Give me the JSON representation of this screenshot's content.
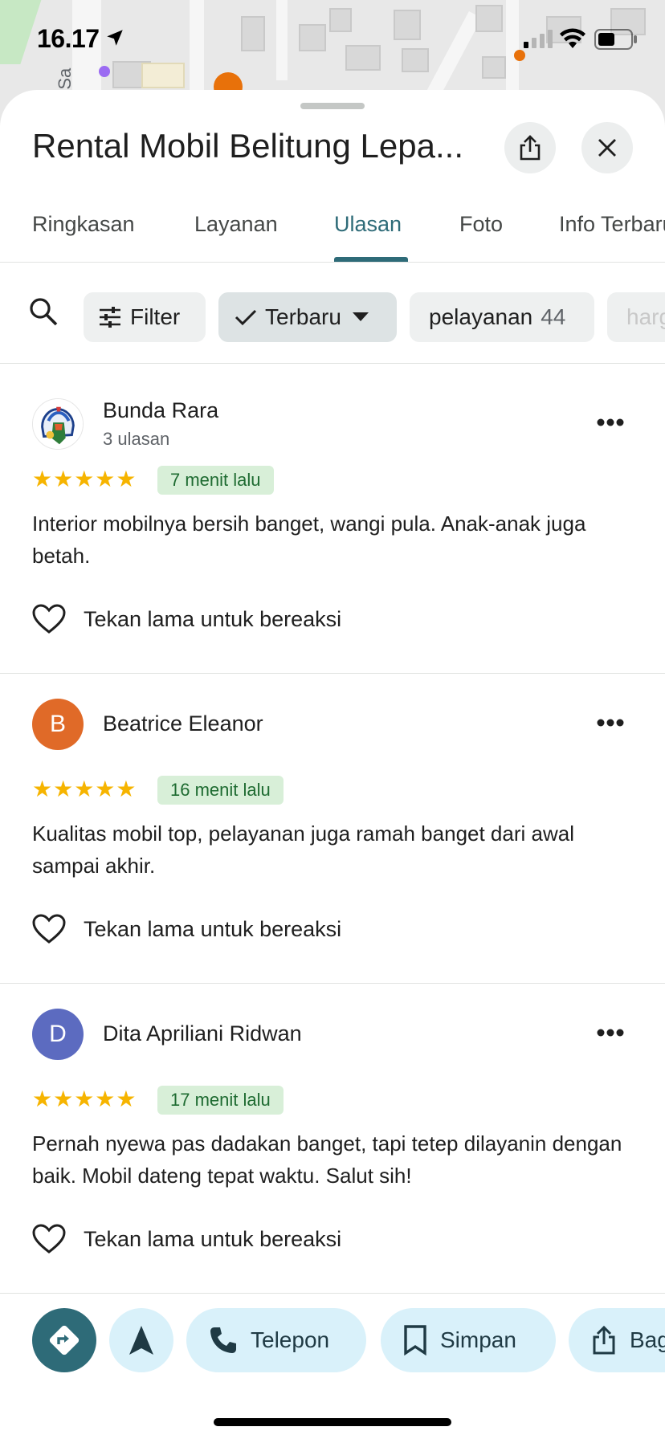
{
  "status_bar": {
    "time": "16.17"
  },
  "map": {
    "street_label": "ir Sa"
  },
  "place": {
    "title": "Rental Mobil Belitung Lepa..."
  },
  "tabs": [
    {
      "label": "Ringkasan",
      "active": false
    },
    {
      "label": "Layanan",
      "active": false
    },
    {
      "label": "Ulasan",
      "active": true
    },
    {
      "label": "Foto",
      "active": false
    },
    {
      "label": "Info Terbaru",
      "active": false
    }
  ],
  "filters": {
    "filter_label": "Filter",
    "sort_label": "Terbaru",
    "topic_chips": [
      {
        "label": "pelayanan",
        "count": "44"
      },
      {
        "label": "harga",
        "count": ""
      }
    ]
  },
  "reviews": [
    {
      "name": "Bunda Rara",
      "subtitle": "3 ulasan",
      "avatar_letter": "",
      "avatar_color": "#ffffff",
      "stars": "★★★★★",
      "rating": 5,
      "time": "7 menit lalu",
      "text": "Interior mobilnya bersih banget, wangi pula. Anak-anak juga betah.",
      "react_label": "Tekan lama untuk bereaksi"
    },
    {
      "name": "Beatrice Eleanor",
      "subtitle": "",
      "avatar_letter": "B",
      "avatar_color": "#e06a28",
      "stars": "★★★★★",
      "rating": 5,
      "time": "16 menit lalu",
      "text": "Kualitas mobil top, pelayanan juga ramah banget dari awal sampai akhir.",
      "react_label": "Tekan lama untuk bereaksi"
    },
    {
      "name": "Dita Apriliani Ridwan",
      "subtitle": "",
      "avatar_letter": "D",
      "avatar_color": "#5c6bc0",
      "stars": "★★★★★",
      "rating": 5,
      "time": "17 menit lalu",
      "text": "Pernah nyewa pas dadakan banget, tapi tetep dilayanin dengan baik. Mobil dateng tepat waktu. Salut sih!",
      "react_label": "Tekan lama untuk bereaksi"
    }
  ],
  "actions": {
    "call_label": "Telepon",
    "save_label": "Simpan",
    "share_label": "Bagikan"
  },
  "colors": {
    "accent": "#2e6b78",
    "star": "#f6b400",
    "badge_bg": "#d8efd8",
    "action_bg": "#d9f1fa"
  }
}
